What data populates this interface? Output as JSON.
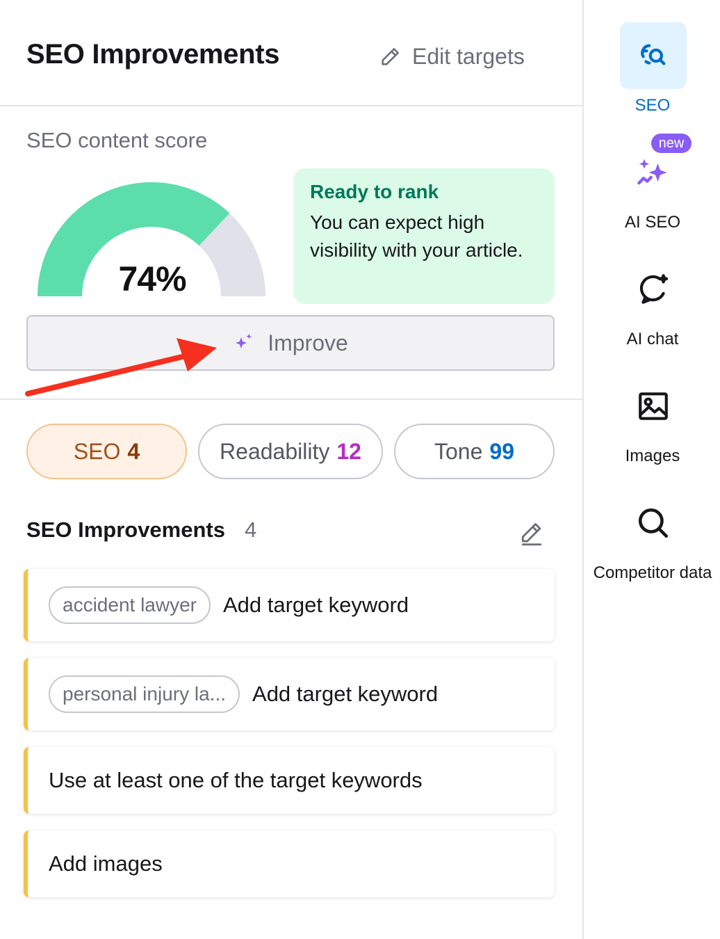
{
  "header": {
    "title": "SEO Improvements",
    "edit_targets": "Edit targets"
  },
  "score": {
    "label": "SEO content score",
    "value": "74%",
    "fraction": 0.74,
    "status_title": "Ready to rank",
    "status_text": "You can expect high visibility with your article.",
    "improve_label": "Improve"
  },
  "tabs": [
    {
      "label": "SEO",
      "count": "4"
    },
    {
      "label": "Readability",
      "count": "12"
    },
    {
      "label": "Tone",
      "count": "99"
    }
  ],
  "improvements": {
    "title": "SEO Improvements",
    "count": "4",
    "items": [
      {
        "chip": "accident lawyer",
        "text": "Add target keyword"
      },
      {
        "chip": "personal injury la...",
        "text": "Add target keyword"
      },
      {
        "text": "Use at least one of the target keywords"
      },
      {
        "text": "Add images"
      }
    ]
  },
  "sidebar": {
    "items": [
      {
        "label": "SEO",
        "icon": "seo-icon"
      },
      {
        "label": "AI SEO",
        "icon": "sparkles-icon",
        "badge": "new"
      },
      {
        "label": "AI chat",
        "icon": "chat-bubble-icon"
      },
      {
        "label": "Images",
        "icon": "image-icon"
      },
      {
        "label": "Competitor data",
        "icon": "search-icon"
      }
    ]
  },
  "colors": {
    "gauge_fill": "#5bdeab",
    "gauge_empty": "#e0e1e9",
    "accent_blue": "#006dca",
    "warning_bar": "#f6c244",
    "annotation_arrow": "#f5301f"
  }
}
